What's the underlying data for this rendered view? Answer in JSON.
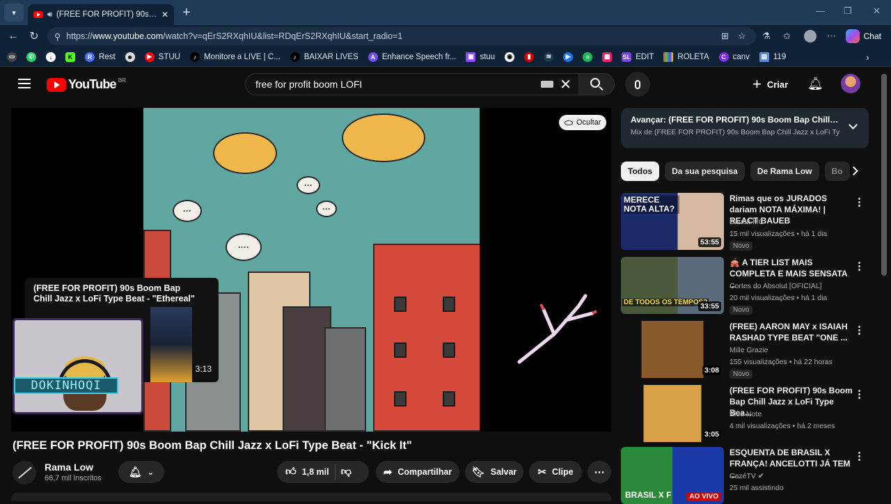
{
  "browser": {
    "tab_title": "(FREE FOR PROFIT) 90s Boom Bap",
    "url_prefix": "https://",
    "url_domain": "www.youtube.com",
    "url_rest": "/watch?v=qErS2RXqhIU&list=RDqErS2RXqhIU&start_radio=1",
    "chat_label": "Chat",
    "bookmarks": [
      "Rest",
      "STUU",
      "Monitore a LIVE | C...",
      "BAIXAR LIVES",
      "Enhance Speech fr...",
      "stuu",
      "EDIT",
      "ROLETA",
      "canv",
      "119"
    ]
  },
  "header": {
    "logo_text": "YouTube",
    "region": "BR",
    "search_value": "free for profit boom LOFI",
    "create_label": "Criar"
  },
  "player": {
    "hide_label": "Ocultar",
    "endcard_title": "(FREE FOR PROFIT) 90s Boom Bap Chill Jazz x LoFi Type Beat - \"Ethereal\"",
    "endcard_duration": "3:13",
    "webcam_name": "DOKINHOQI"
  },
  "video": {
    "title": "(FREE FOR PROFIT) 90s Boom Bap Chill Jazz x LoFi Type Beat - \"Kick It\"",
    "channel": "Rama Low",
    "subscribers": "66,7 mil inscritos",
    "likes": "1,8 mil",
    "share_label": "Compartilhar",
    "save_label": "Salvar",
    "clip_label": "Clipe"
  },
  "sidebar": {
    "upnext_title": "Avançar: (FREE FOR PROFIT) 90s Boom Bap Chill J...",
    "upnext_sub": "Mix de (FREE FOR PROFIT) 90s Boom Bap Chill Jazz x LoFi Typ",
    "chips": [
      "Todos",
      "Da sua pesquisa",
      "De Rama Low",
      "Bo"
    ],
    "recs": [
      {
        "title": "Rimas que os JURADOS dariam NOTA MÁXIMA! | REACT BAUEB",
        "channel": "Baueb MC",
        "meta": "15 mil visualizações • há 1 dia",
        "badge": "Novo",
        "duration": "53:55"
      },
      {
        "title": "🎪 A TIER LIST MAIS COMPLETA E MAIS SENSATA ...",
        "channel": "Cortes do Absolut [OFICIAL]",
        "meta": "20 mil visualizações • há 1 dia",
        "badge": "Novo",
        "duration": "33:55"
      },
      {
        "title": "(FREE) AARON MAY x ISAIAH RASHAD TYPE BEAT \"ONE ...",
        "channel": "Mille Grazie",
        "meta": "155 visualizações • há 22 horas",
        "badge": "Novo",
        "duration": "3:08"
      },
      {
        "title": "(FREE FOR PROFIT) 90s Boom Bap Chill Jazz x LoFi Type Bea...",
        "channel": "Blue Note",
        "meta": "4 mil visualizações • há 2 meses",
        "badge": "",
        "duration": "3:05"
      },
      {
        "title": "ESQUENTA DE BRASIL X FRANÇA! ANCELOTTI JÁ TEM ...",
        "channel": "CazéTV ✔",
        "meta": "25 mil assistindo",
        "badge": "",
        "duration": "AO VIVO"
      }
    ],
    "thumb_texts": {
      "merece": "MERECE NOTA ALTA?",
      "tier": "DE TODOS OS TEMPOS?",
      "brasil": "BRASIL X F"
    }
  },
  "colors": {
    "accent_red": "#ff0000",
    "bg": "#0f0f0f",
    "chip_bg": "#272727"
  }
}
